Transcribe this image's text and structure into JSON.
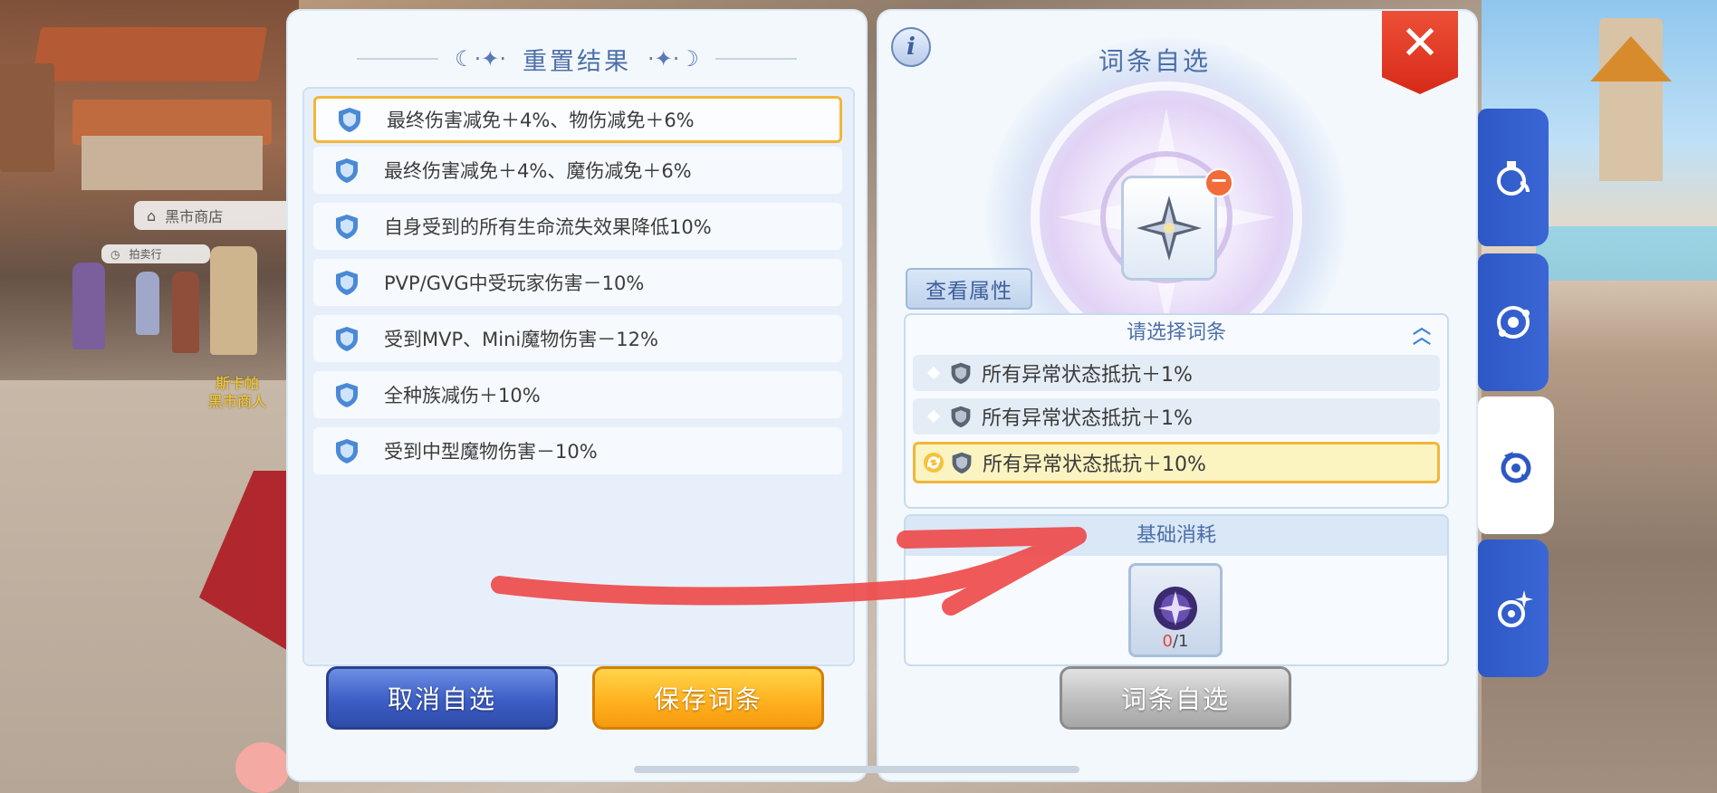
{
  "background": {
    "npc_shop_label": "黑市商店",
    "npc_auction_label": "拍卖行",
    "npc_name_line1": "斯卡帕",
    "npc_name_line2": "黑市商人"
  },
  "left_panel": {
    "title": "重置结果",
    "results": [
      {
        "text": "最终伤害减免＋4%、物伤减免＋6%",
        "selected": true
      },
      {
        "text": "最终伤害减免＋4%、魔伤减免＋6%",
        "selected": false
      },
      {
        "text": "自身受到的所有生命流失效果降低10%",
        "selected": false
      },
      {
        "text": "PVP/GVG中受玩家伤害－10%",
        "selected": false
      },
      {
        "text": "受到MVP、Mini魔物伤害－12%",
        "selected": false
      },
      {
        "text": "全种族减伤＋10%",
        "selected": false
      },
      {
        "text": "受到中型魔物伤害－10%",
        "selected": false
      }
    ],
    "cancel_label": "取消自选",
    "save_label": "保存词条"
  },
  "right_panel": {
    "title": "词条自选",
    "view_attrs_label": "查看属性",
    "select_header": "请选择词条",
    "options": [
      {
        "text": "所有异常状态抵抗＋1%",
        "selected": false
      },
      {
        "text": "所有异常状态抵抗＋1%",
        "selected": false
      },
      {
        "text": "所有异常状态抵抗＋10%",
        "selected": true
      }
    ],
    "cost_header": "基础消耗",
    "cost_have": "0",
    "cost_need": "/1",
    "custom_label": "词条自选"
  },
  "colors": {
    "accent_blue": "#4d6fa8",
    "selected_border": "#f1b73a",
    "close_red": "#d72a19",
    "tab_blue": "#2d57c4",
    "annotation_red": "#ee4b4b"
  },
  "icons": {
    "close": "close-icon",
    "info": "info-icon",
    "shield": "shield-icon",
    "remove": "minus-icon",
    "refresh": "refresh-icon",
    "collapse": "chevron-up-icon"
  },
  "side_tabs": [
    "potion-tab",
    "orbit-tab",
    "refine-tab",
    "sparkle-tab"
  ],
  "active_side_tab": 2
}
